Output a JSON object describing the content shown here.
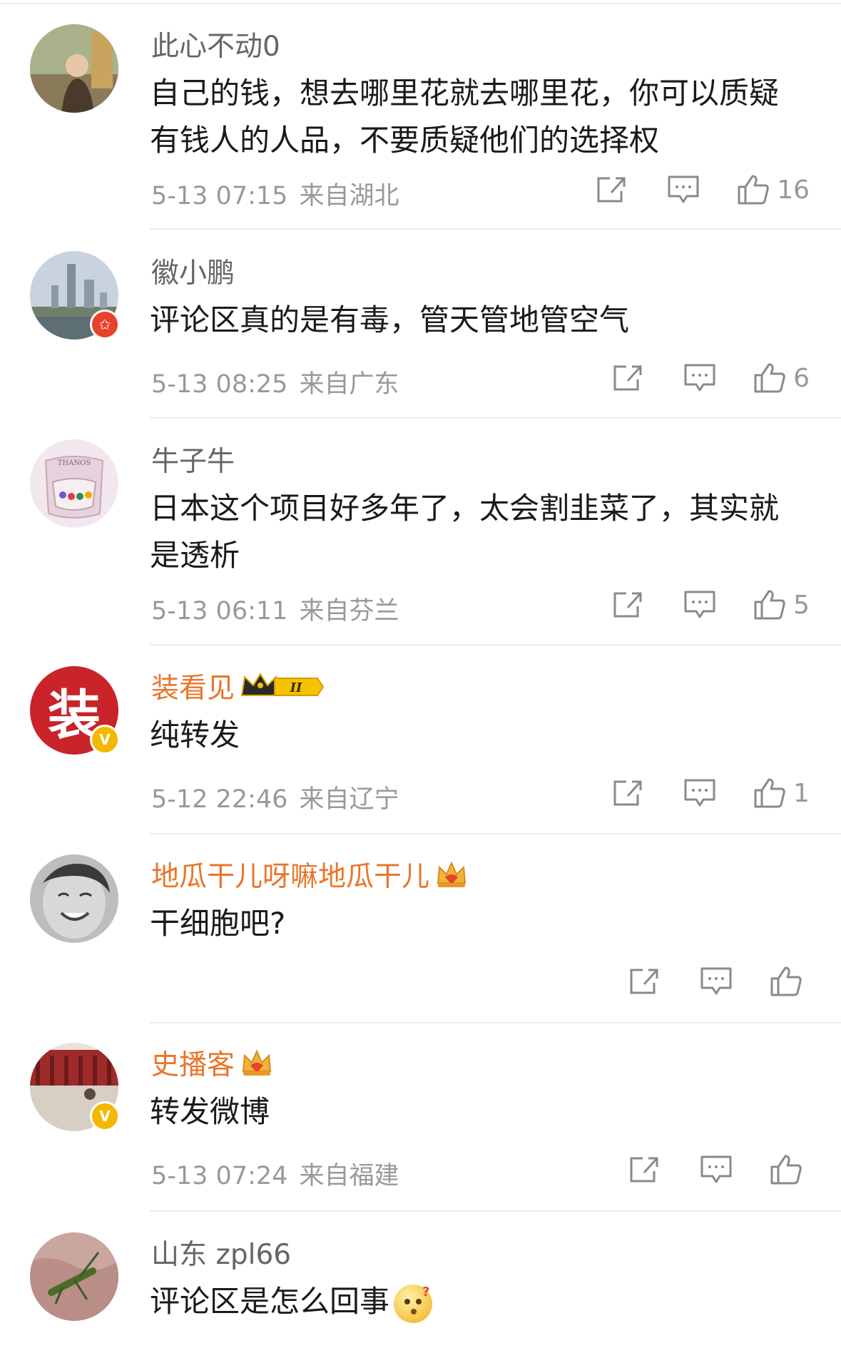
{
  "comments": [
    {
      "username": "此心不动0",
      "text": "自己的钱，想去哪里花就去哪里花，你可以质疑有钱人的人品，不要质疑他们的选择权",
      "time": "5-13 07:15",
      "location": "来自湖北",
      "likes": "16"
    },
    {
      "username": "徽小鹏",
      "text": "评论区真的是有毒，管天管地管空气",
      "time": "5-13 08:25",
      "location": "来自广东",
      "likes": "6"
    },
    {
      "username": "牛子牛",
      "text": "日本这个项目好多年了，太会割韭菜了，其实就是透析",
      "time": "5-13 06:11",
      "location": "来自芬兰",
      "likes": "5",
      "avatar_text": "THANOS"
    },
    {
      "username": "装看见",
      "text": "纯转发",
      "time": "5-12 22:46",
      "location": "来自辽宁",
      "likes": "1",
      "avatar_text": "装",
      "vip_level": "II"
    },
    {
      "username": "地瓜干儿呀嘛地瓜干儿",
      "text": "干细胞吧?",
      "time": "",
      "location": "",
      "likes": ""
    },
    {
      "username": "史播客",
      "text": "转发微博",
      "time": "5-13 07:24",
      "location": "来自福建",
      "likes": ""
    },
    {
      "username": "山东 zpl66",
      "text": "评论区是怎么回事",
      "time": "",
      "location": "",
      "likes": ""
    }
  ],
  "icons": {
    "repost": "share-icon",
    "comment": "comment-icon",
    "like": "thumbs-up-icon"
  },
  "colors": {
    "vip_name": "#e8762c",
    "verified_badge": "#f5b800",
    "red_badge": "#e8412c"
  }
}
